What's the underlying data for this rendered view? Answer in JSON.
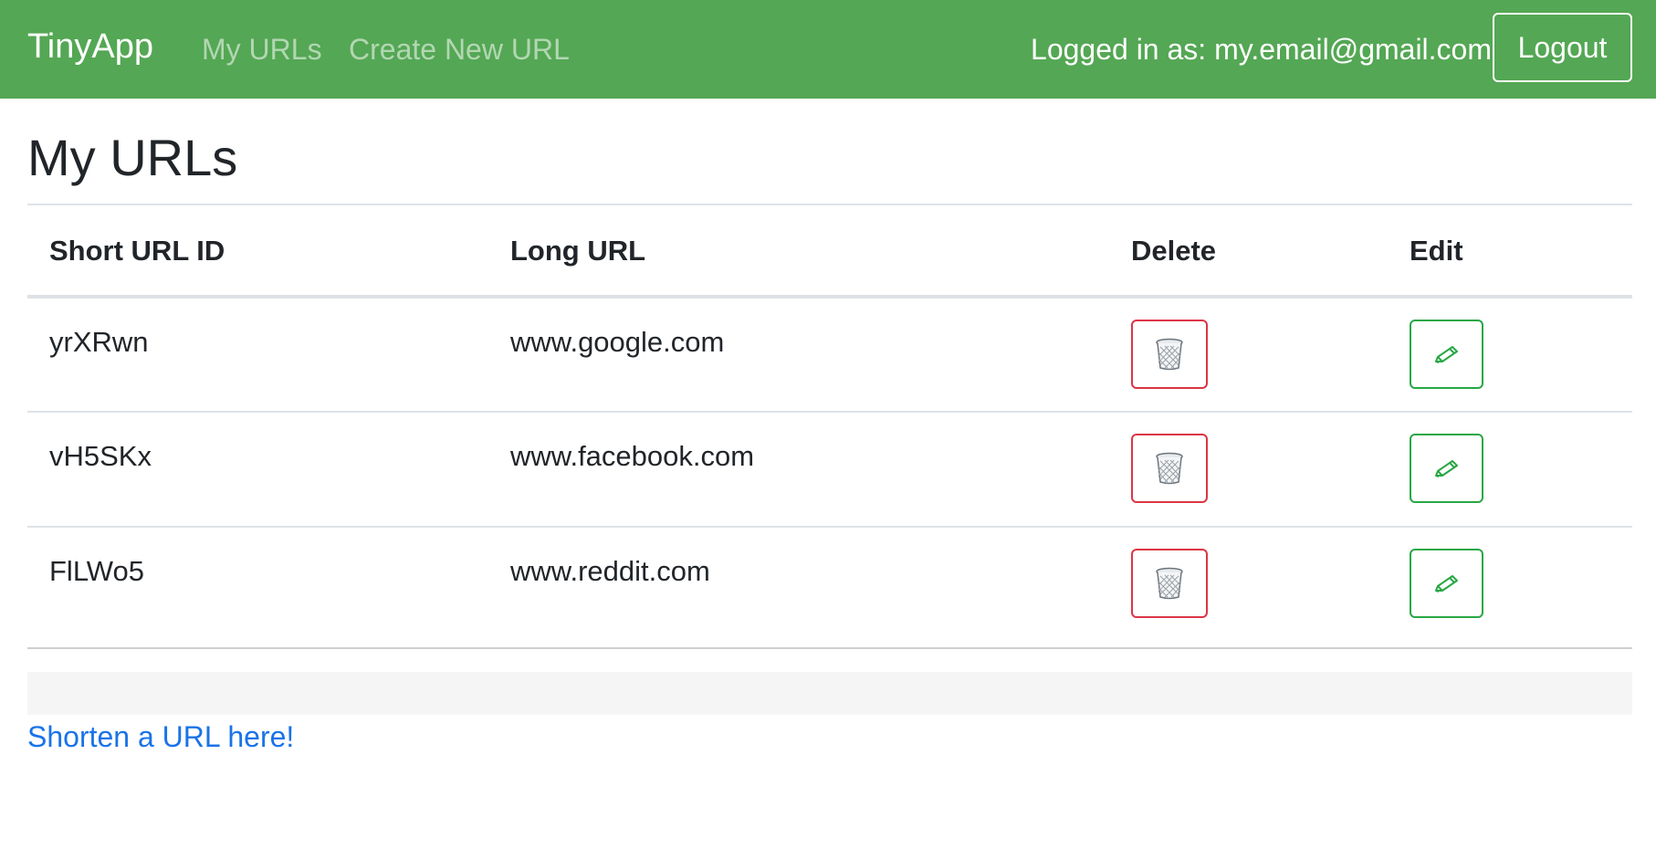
{
  "nav": {
    "brand": "TinyApp",
    "links": [
      "My URLs",
      "Create New URL"
    ],
    "logged_in_text": "Logged in as: my.email@gmail.com",
    "logout_label": "Logout",
    "bg_color": "#54a754"
  },
  "main": {
    "title": "My URLs",
    "table": {
      "headers": [
        "Short URL ID",
        "Long URL",
        "Delete",
        "Edit"
      ],
      "rows": [
        {
          "short_id": "yrXRwn",
          "long_url": "www.google.com",
          "delete_icon": "trash-icon",
          "edit_icon": "pencil-icon"
        },
        {
          "short_id": "vH5SKx",
          "long_url": "www.facebook.com",
          "delete_icon": "trash-icon",
          "edit_icon": "pencil-icon"
        },
        {
          "short_id": "FlLWo5",
          "long_url": "www.reddit.com",
          "delete_icon": "trash-icon",
          "edit_icon": "pencil-icon"
        }
      ]
    },
    "shorten_link": "Shorten a URL here!"
  },
  "colors": {
    "delete_border": "#dc3545",
    "edit_border": "#28a745",
    "link": "#1a73e8"
  }
}
